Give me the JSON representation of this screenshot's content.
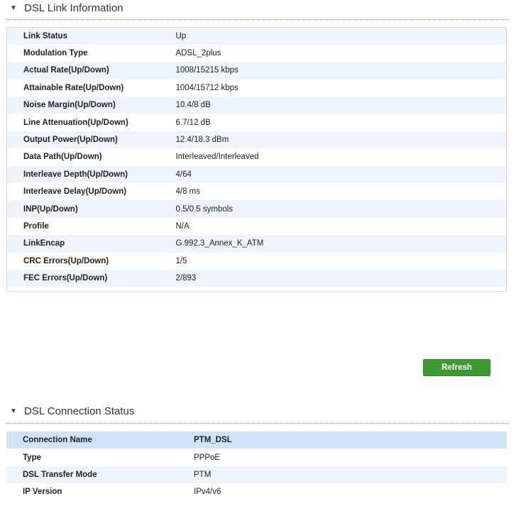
{
  "link_info": {
    "title": "DSL Link Information",
    "rows": [
      {
        "label": "Link Status",
        "value": "Up"
      },
      {
        "label": "Modulation Type",
        "value": "ADSL_2plus"
      },
      {
        "label": "Actual Rate(Up/Down)",
        "value": "1008/15215 kbps"
      },
      {
        "label": "Attainable Rate(Up/Down)",
        "value": "1004/15712 kbps"
      },
      {
        "label": "Noise Margin(Up/Down)",
        "value": "10.4/8 dB"
      },
      {
        "label": "Line Attenuation(Up/Down)",
        "value": "6.7/12 dB"
      },
      {
        "label": "Output Power(Up/Down)",
        "value": "12.4/18.3 dBm"
      },
      {
        "label": "Data Path(Up/Down)",
        "value": "Interleaved/Interleaved"
      },
      {
        "label": "Interleave Depth(Up/Down)",
        "value": "4/64"
      },
      {
        "label": "Interleave Delay(Up/Down)",
        "value": "4/8 ms"
      },
      {
        "label": "INP(Up/Down)",
        "value": "0.5/0.5 symbols"
      },
      {
        "label": "Profile",
        "value": "N/A"
      },
      {
        "label": "LinkEncap",
        "value": "G.992.3_Annex_K_ATM"
      },
      {
        "label": "CRC Errors(Up/Down)",
        "value": "1/5"
      },
      {
        "label": "FEC Errors(Up/Down)",
        "value": "2/893"
      }
    ],
    "refresh_label": "Refresh"
  },
  "connection_status": {
    "title": "DSL Connection Status",
    "header": {
      "label": "Connection Name",
      "value": "PTM_DSL"
    },
    "rows": [
      {
        "label": "Type",
        "value": "PPPoE"
      },
      {
        "label": "DSL Transfer Mode",
        "value": "PTM"
      },
      {
        "label": "IP Version",
        "value": "IPv4/v6"
      }
    ]
  },
  "icons": {
    "collapse": "triangle-down-icon"
  },
  "colors": {
    "row_alt": "#eef4fb",
    "header_row": "#cfe3f7",
    "refresh_button": "#3c9a32"
  }
}
